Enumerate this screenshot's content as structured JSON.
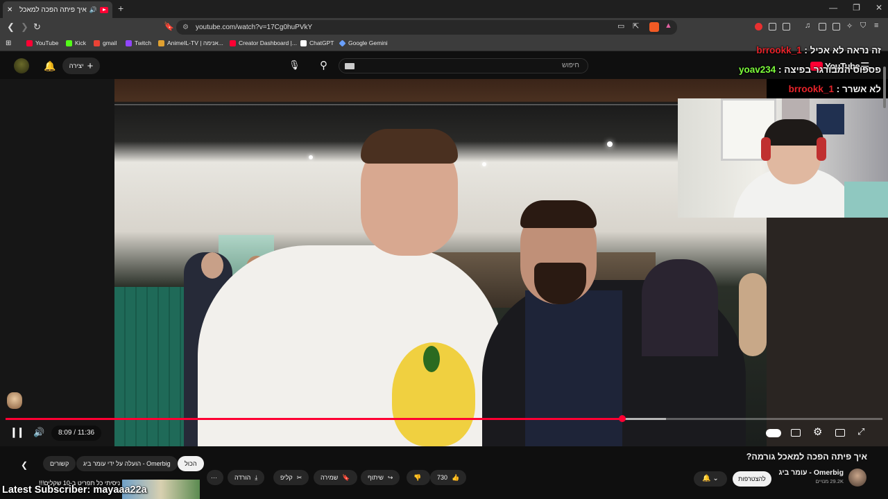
{
  "browser": {
    "tab_title": "איך פיתה הפכה למאכל גורמה?",
    "new_tab": "+",
    "url": "youtube.com/watch?v=17Cg0huPVkY",
    "window_controls": [
      "—",
      "❐",
      "✕"
    ],
    "bookmarks": [
      {
        "label": "YouTube",
        "color": "#ff0033"
      },
      {
        "label": "Kick",
        "color": "#53fc18"
      },
      {
        "label": "gmail",
        "color": "#ea4335"
      },
      {
        "label": "Twitch",
        "color": "#9146ff"
      },
      {
        "label": "AnimeIL-TV | אנימה...",
        "color": "#e0a030"
      },
      {
        "label": "Creator Dashboard |...",
        "color": "#ff0033"
      },
      {
        "label": "ChatGPT",
        "color": "#ffffff"
      },
      {
        "label": "Google Gemini",
        "color": "#6aa0ff"
      }
    ]
  },
  "youtube": {
    "search_placeholder": "חיפוש",
    "create_label": "יצירה",
    "logo_text": "YouTube",
    "logo_sup": "IL"
  },
  "player": {
    "current_time": "8:09",
    "duration": "11:36",
    "time_display": "8:09 / 11:36",
    "progress_fraction": 0.703,
    "buffer_fraction": 0.753
  },
  "overlay": {
    "chat": [
      {
        "user": "brrookk_1",
        "sep": " : ",
        "message": "זה נראה לא אכיל",
        "user_color": "#e8232a"
      },
      {
        "user": "yoav234",
        "sep": " : ",
        "message": "פספוס המבורגר בפיצה",
        "user_color": "#7cfc3a"
      },
      {
        "user": "brrookk_1",
        "sep": " : ",
        "message": "לא אשרר",
        "user_color": "#e8232a"
      }
    ],
    "latest_subscriber": "Latest Subscriber: mayaaa22a",
    "thumb_text": "ניסיתי כל תפריט ב-10 שקלים!!!"
  },
  "video": {
    "title": "איך פיתה הפכה למאכל גורמה?",
    "channel_name": "Omerbig - עומר ביג",
    "subscribers": "29.2K מנויים",
    "subscribe_label": "להצטרפות",
    "likes": "730",
    "share_label": "שיתוף",
    "save_label": "שמירה",
    "clip_label": "קליפ",
    "download_label": "הורדה",
    "more_label": "⋯",
    "chips": [
      "הכול",
      "הועלה על ידי עומר ביג - Omerbig",
      "קשורים"
    ]
  }
}
